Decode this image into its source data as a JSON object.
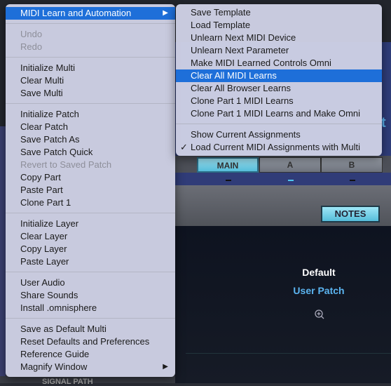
{
  "main_menu": {
    "sections": [
      [
        {
          "label": "MIDI Learn and Automation",
          "highlighted": true,
          "submenu": true
        }
      ],
      [
        {
          "label": "Undo",
          "disabled": true
        },
        {
          "label": "Redo",
          "disabled": true
        }
      ],
      [
        {
          "label": "Initialize Multi"
        },
        {
          "label": "Clear Multi"
        },
        {
          "label": "Save Multi"
        }
      ],
      [
        {
          "label": "Initialize Patch"
        },
        {
          "label": "Clear Patch"
        },
        {
          "label": "Save Patch As"
        },
        {
          "label": "Save Patch Quick"
        },
        {
          "label": "Revert to Saved Patch",
          "disabled": true
        },
        {
          "label": "Copy Part"
        },
        {
          "label": "Paste Part"
        },
        {
          "label": "Clone Part 1"
        }
      ],
      [
        {
          "label": "Initialize Layer"
        },
        {
          "label": "Clear Layer"
        },
        {
          "label": "Copy Layer"
        },
        {
          "label": "Paste Layer"
        }
      ],
      [
        {
          "label": "User Audio"
        },
        {
          "label": "Share Sounds"
        },
        {
          "label": "Install .omnisphere"
        }
      ],
      [
        {
          "label": "Save as Default Multi"
        },
        {
          "label": "Reset Defaults and Preferences"
        },
        {
          "label": "Reference Guide"
        },
        {
          "label": "Magnify Window",
          "submenu": true
        }
      ]
    ]
  },
  "submenu": {
    "sections": [
      [
        {
          "label": "Save Template"
        },
        {
          "label": "Load Template"
        },
        {
          "label": "Unlearn Next MIDI Device"
        },
        {
          "label": "Unlearn Next Parameter"
        },
        {
          "label": "Make MIDI Learned Controls Omni"
        },
        {
          "label": "Clear All MIDI Learns",
          "highlighted": true
        },
        {
          "label": "Clear All Browser Learns"
        },
        {
          "label": "Clone Part 1 MIDI Learns"
        },
        {
          "label": "Clone Part 1 MIDI Learns and Make Omni"
        }
      ],
      [
        {
          "label": "Show Current Assignments"
        },
        {
          "label": "Load Current MIDI Assignments with Multi",
          "checked": true
        }
      ]
    ]
  },
  "app": {
    "tabs": [
      "MAIN",
      "A",
      "B"
    ],
    "active_tab": "MAIN",
    "notes_button": "NOTES",
    "patch_name": "Default",
    "patch_type": "User Patch",
    "bottom_label": "SIGNAL PATH",
    "partial_title_char": "t"
  },
  "colors": {
    "highlight": "#1e6fd9",
    "accent_cyan": "#6fd3ee",
    "patch_type": "#5bb4f0"
  },
  "symbols": {
    "arrow": "▶",
    "check": "✓"
  }
}
